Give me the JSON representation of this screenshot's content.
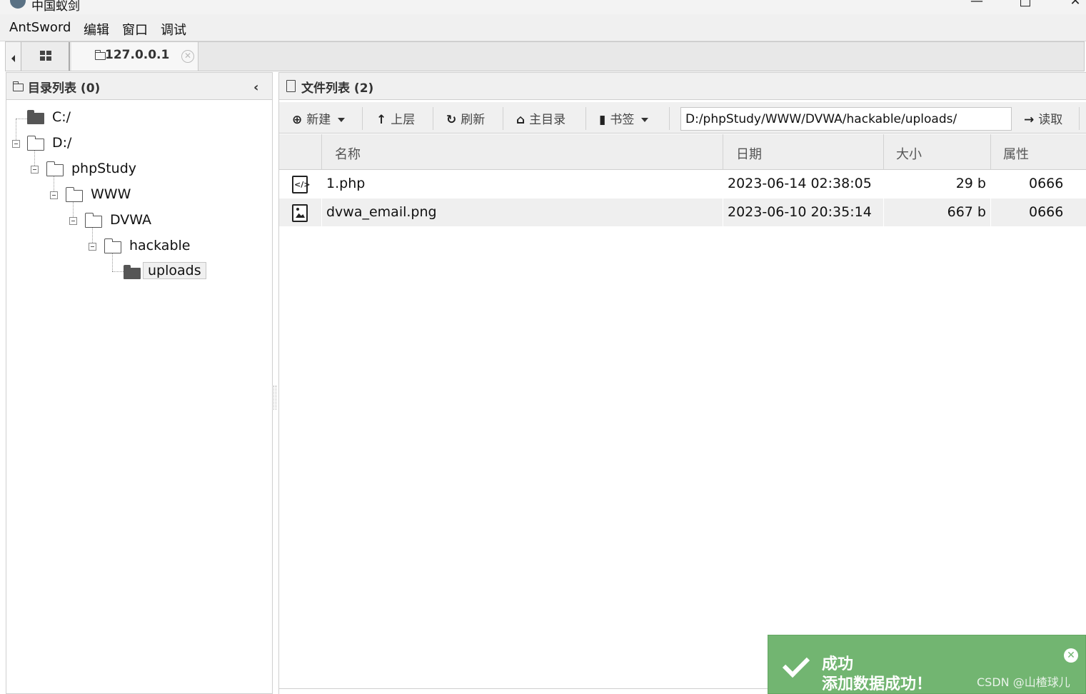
{
  "window": {
    "title": "中国蚁剑",
    "icon": "antsword-logo-icon",
    "controls": [
      "minimize-icon",
      "maximize-icon",
      "close-icon"
    ]
  },
  "menu": [
    "AntSword",
    "编辑",
    "窗口",
    "调试"
  ],
  "tabs": {
    "home_icon": "grid-icon",
    "host_label": "127.0.0.1"
  },
  "left_panel": {
    "title": "目录列表 (0)",
    "tree": [
      {
        "label": "C:/",
        "depth": 0
      },
      {
        "label": "D:/",
        "depth": 0
      },
      {
        "label": "phpStudy",
        "depth": 1
      },
      {
        "label": "WWW",
        "depth": 2
      },
      {
        "label": "DVWA",
        "depth": 3
      },
      {
        "label": "hackable",
        "depth": 4
      },
      {
        "label": "uploads",
        "depth": 5,
        "selected": true
      }
    ]
  },
  "right_panel": {
    "title": "文件列表 (2)",
    "toolbar": {
      "new": "新建",
      "up": "上层",
      "refresh": "刷新",
      "home": "主目录",
      "bookmark": "书签",
      "path": "D:/phpStudy/WWW/DVWA/hackable/uploads/",
      "read": "读取"
    },
    "columns": [
      "名称",
      "日期",
      "大小",
      "属性"
    ],
    "files": [
      {
        "icon": "php-file-icon",
        "name": "1.php",
        "date": "2023-06-14 02:38:05",
        "size": "29 b",
        "attr": "0666"
      },
      {
        "icon": "image-file-icon",
        "name": "dvwa_email.png",
        "date": "2023-06-10 20:35:14",
        "size": "667 b",
        "attr": "0666"
      }
    ]
  },
  "toast": {
    "title": "成功",
    "message": "添加数据成功！",
    "color": "#72b571"
  },
  "watermark": "CSDN @山楂球儿"
}
